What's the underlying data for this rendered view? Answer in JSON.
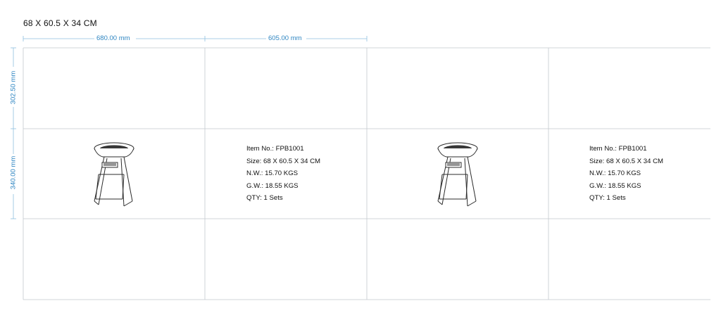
{
  "title": "68 X 60.5 X 34 CM",
  "dimensions": {
    "top_left": "680.00 mm",
    "top_right": "605.00 mm",
    "left_top": "302.50 mm",
    "left_bottom": "340.00 mm"
  },
  "panels": [
    {
      "item_no": "Item No.: FPB1001",
      "size": "Size: 68 X 60.5 X 34 CM",
      "nw": "N.W.: 15.70 KGS",
      "gw": "G.W.: 18.55 KGS",
      "qty": "QTY: 1 Sets"
    },
    {
      "item_no": "Item No.: FPB1001",
      "size": "Size: 68 X 60.5 X 34 CM",
      "nw": "N.W.: 15.70 KGS",
      "gw": "G.W.: 18.55 KGS",
      "qty": "QTY: 1 Sets"
    }
  ],
  "colors": {
    "dimension": "#2f86c2",
    "grid": "#bfc6cc",
    "line": "#2b2b2b"
  },
  "icons": [
    "fire-pit-icon"
  ]
}
